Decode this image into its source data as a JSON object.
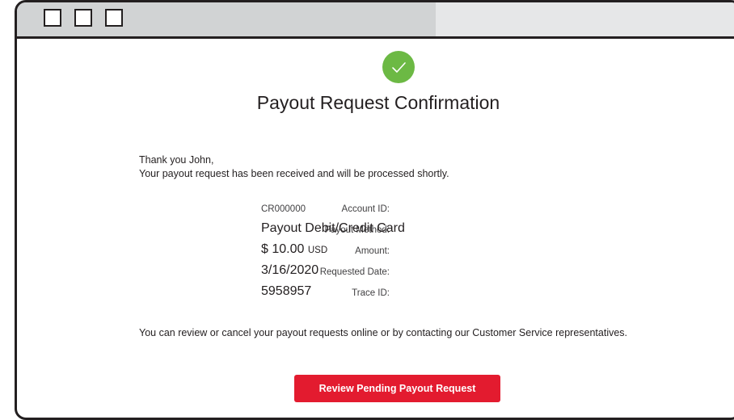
{
  "page": {
    "title": "Payout Request Confirmation",
    "greeting_line1": "Thank you John,",
    "greeting_line2": "Your payout request has been received and will be processed shortly."
  },
  "details": [
    {
      "label": "Account ID:",
      "value": "CR000000",
      "unit": ""
    },
    {
      "label": "Payout Method:",
      "value": "Payout Debit/Credit Card",
      "unit": ""
    },
    {
      "label": "Amount:",
      "value": "$ 10.00",
      "unit": "USD"
    },
    {
      "label": "Requested Date:",
      "value": "3/16/2020",
      "unit": ""
    },
    {
      "label": "Trace ID:",
      "value": "5958957",
      "unit": ""
    }
  ],
  "footer_text": "You can review or cancel your payout requests online or by contacting our Customer Service representatives.",
  "actions": {
    "review_button_label": "Review Pending Payout Request"
  },
  "colors": {
    "success": "#6cb944",
    "primary_button": "#e31b2f",
    "titlebar": "#d1d3d4"
  },
  "icons": {
    "status": "check-icon"
  }
}
